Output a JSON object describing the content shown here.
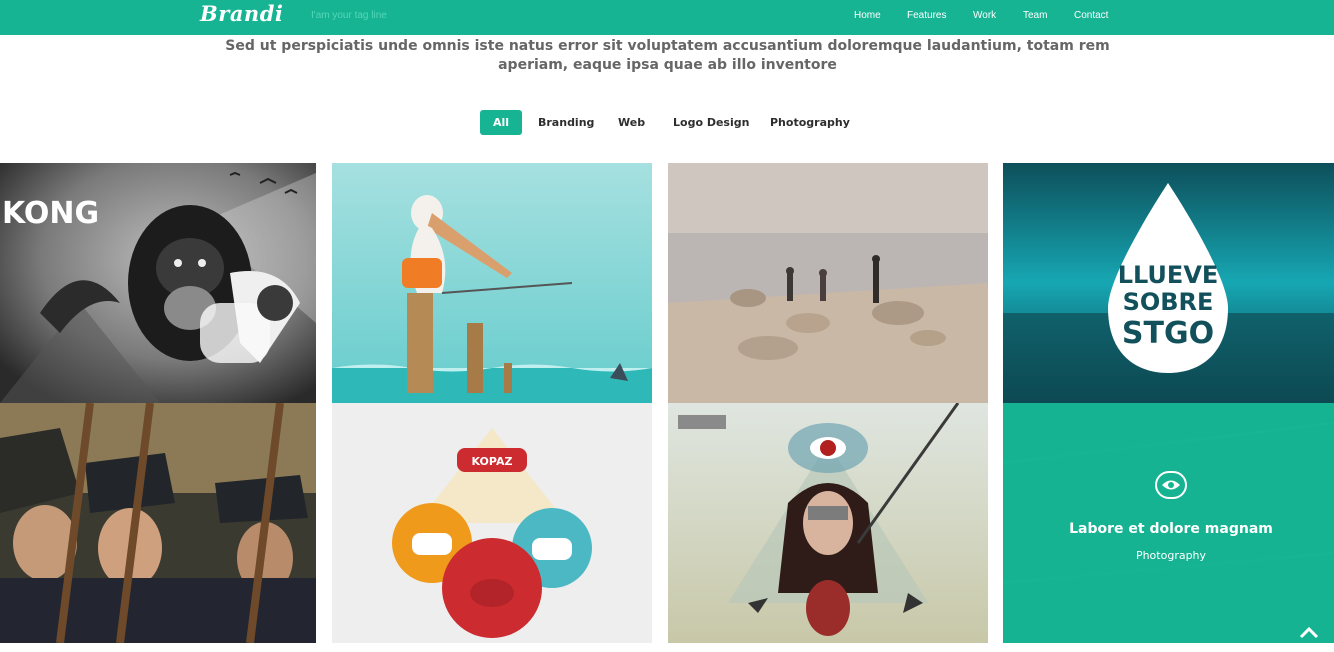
{
  "nav": {
    "brand": "Brandi",
    "tagline": "I'am your tag line",
    "items": [
      "Home",
      "Features",
      "Work",
      "Team",
      "Contact"
    ]
  },
  "intro": "Sed ut perspiciatis unde omnis iste natus error sit voluptatem accusantium doloremque laudantium, totam rem aperiam, eaque ipsa quae ab illo inventore",
  "filters": [
    "All",
    "Branding",
    "Web",
    "Logo Design",
    "Photography"
  ],
  "active_filter": "All",
  "portfolio": {
    "kong_text": "KONG",
    "drop_lines": [
      "LLUEVE",
      "SOBRE",
      "STGO"
    ],
    "kopaz_text": "KOPAZ",
    "overlay_title": "Labore et dolore magnam",
    "overlay_category": "Photography"
  },
  "colors": {
    "accent": "#16b493",
    "intro_text": "#666666"
  },
  "icons": {
    "overlay": "eye-icon",
    "back_to_top": "chevron-up-icon"
  }
}
